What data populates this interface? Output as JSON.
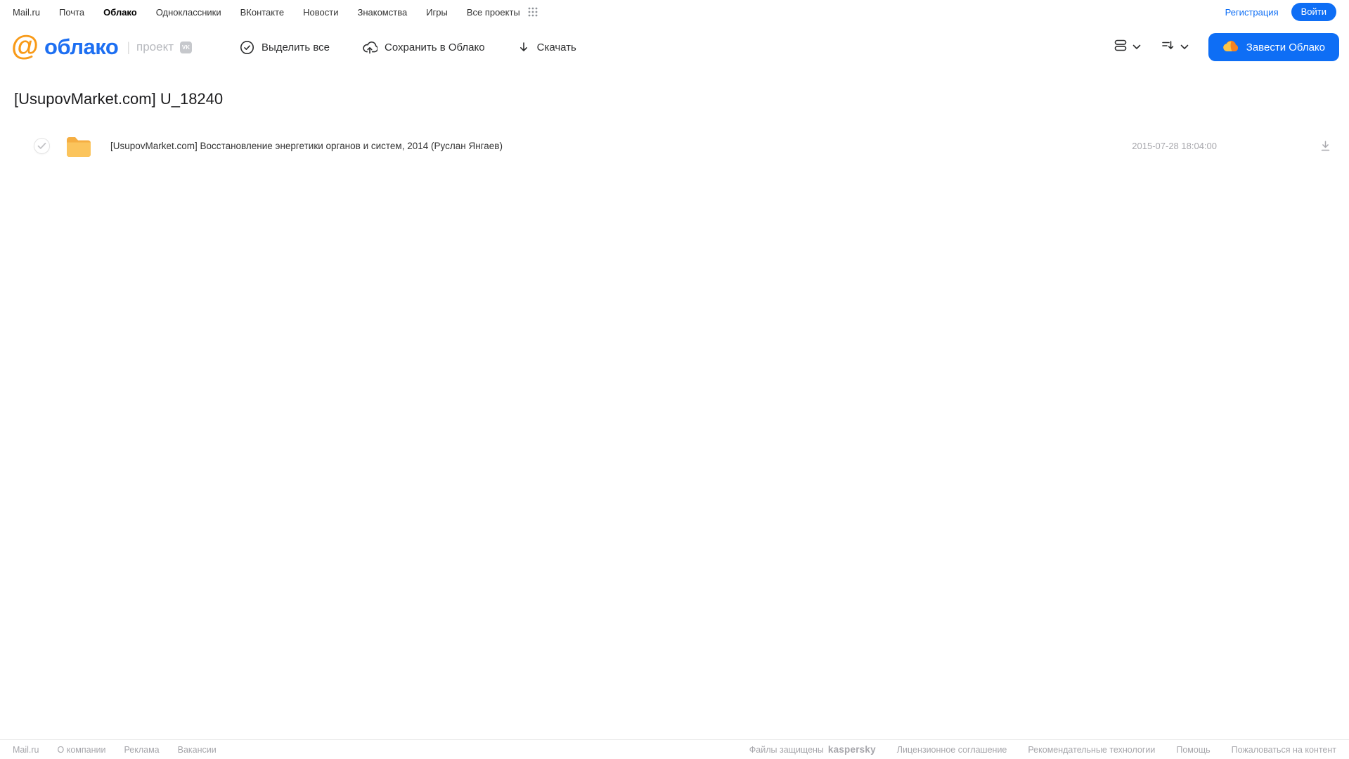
{
  "topnav": {
    "items": [
      {
        "label": "Mail.ru"
      },
      {
        "label": "Почта"
      },
      {
        "label": "Облако",
        "active": true
      },
      {
        "label": "Одноклассники"
      },
      {
        "label": "ВКонтакте"
      },
      {
        "label": "Новости"
      },
      {
        "label": "Знакомства"
      },
      {
        "label": "Игры"
      },
      {
        "label": "Все проекты"
      }
    ],
    "registration_label": "Регистрация",
    "login_label": "Войти"
  },
  "header": {
    "logo_at": "@",
    "logo_text": "облако",
    "project_label": "проект",
    "vk_badge": "VK",
    "actions": {
      "select_all": "Выделить все",
      "save_to_cloud": "Сохранить в Облако",
      "download": "Скачать"
    },
    "get_cloud_label": "Завести Облако"
  },
  "main": {
    "title": "[UsupovMarket.com] U_18240",
    "files": [
      {
        "type": "folder",
        "name": "[UsupovMarket.com] Восстановление энергетики органов и систем, 2014 (Руслан Янгаев)",
        "date": "2015-07-28 18:04:00"
      }
    ]
  },
  "footer": {
    "left_links": [
      {
        "label": "Mail.ru"
      },
      {
        "label": "О компании"
      },
      {
        "label": "Реклама"
      },
      {
        "label": "Вакансии"
      }
    ],
    "protected_text": "Файлы защищены",
    "kaspersky_label": "kaspersky",
    "right_links": [
      {
        "label": "Лицензионное соглашение"
      },
      {
        "label": "Рекомендательные технологии"
      },
      {
        "label": "Помощь"
      },
      {
        "label": "Пожаловаться на контент"
      }
    ]
  },
  "colors": {
    "accent_blue": "#0e6ef5",
    "logo_blue": "#1d6ff2",
    "logo_orange": "#f89a18",
    "folder_yellow": "#fbc45c",
    "folder_yellow_dark": "#f5ae42",
    "kaspersky_green": "#00a88e",
    "muted_gray": "#a6a6ab"
  }
}
